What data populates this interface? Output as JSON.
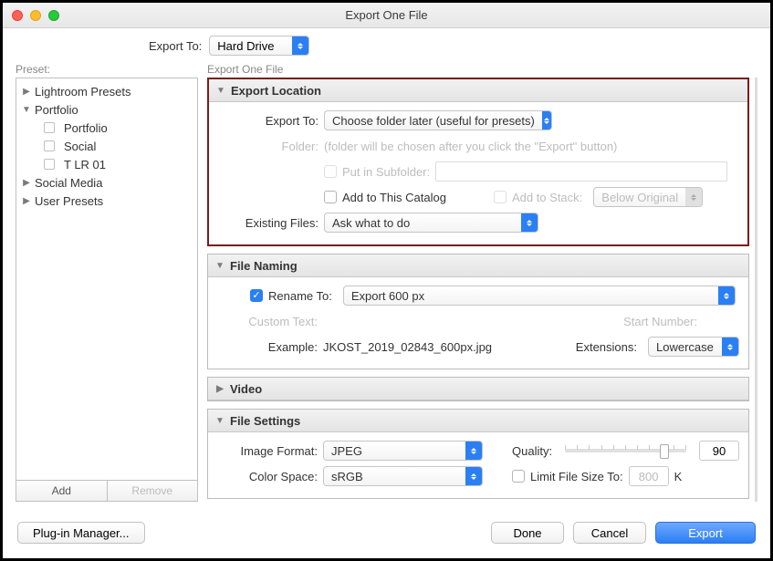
{
  "window": {
    "title": "Export One File"
  },
  "top": {
    "exportToLabel": "Export To:",
    "exportToValue": "Hard Drive"
  },
  "preset": {
    "label": "Preset:",
    "nodes": [
      {
        "label": "Lightroom Presets",
        "expanded": false,
        "level": 0
      },
      {
        "label": "Portfolio",
        "expanded": true,
        "level": 0
      },
      {
        "label": "Portfolio",
        "check": true,
        "level": 1
      },
      {
        "label": "Social",
        "check": true,
        "level": 1
      },
      {
        "label": "T LR 01",
        "check": true,
        "level": 1
      },
      {
        "label": "Social Media",
        "expanded": false,
        "level": 0
      },
      {
        "label": "User Presets",
        "expanded": false,
        "level": 0
      }
    ],
    "add": "Add",
    "remove": "Remove"
  },
  "right": {
    "label": "Export One File"
  },
  "sections": {
    "exportLocation": {
      "title": "Export Location",
      "exportToLabel": "Export To:",
      "exportToValue": "Choose folder later (useful for presets)",
      "folderLabel": "Folder:",
      "folderHint": "(folder will be chosen after you click the \"Export\" button)",
      "subfolderLabel": "Put in Subfolder:",
      "addCatalog": "Add to This Catalog",
      "addStack": "Add to Stack:",
      "stackValue": "Below Original",
      "existingLabel": "Existing Files:",
      "existingValue": "Ask what to do"
    },
    "fileNaming": {
      "title": "File Naming",
      "renameLabel": "Rename To:",
      "renameValue": "Export 600 px",
      "customLabel": "Custom Text:",
      "startLabel": "Start Number:",
      "exampleLabel": "Example:",
      "exampleValue": "JKOST_2019_02843_600px.jpg",
      "extLabel": "Extensions:",
      "extValue": "Lowercase"
    },
    "video": {
      "title": "Video"
    },
    "fileSettings": {
      "title": "File Settings",
      "formatLabel": "Image Format:",
      "formatValue": "JPEG",
      "qualityLabel": "Quality:",
      "qualityValue": "90",
      "spaceLabel": "Color Space:",
      "spaceValue": "sRGB",
      "limitLabel": "Limit File Size To:",
      "limitValue": "800",
      "limitUnit": "K"
    }
  },
  "footer": {
    "plugin": "Plug-in Manager...",
    "done": "Done",
    "cancel": "Cancel",
    "export": "Export"
  }
}
